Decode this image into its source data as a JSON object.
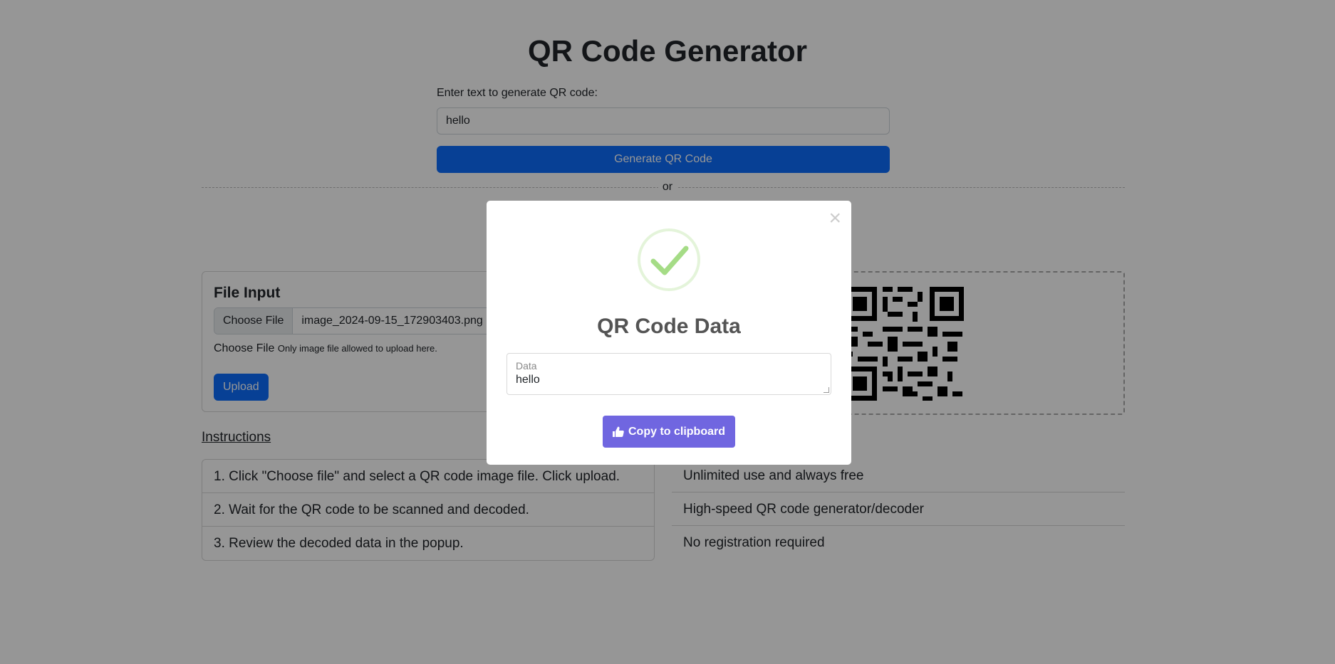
{
  "page": {
    "title": "QR Code Generator",
    "generate_label": "Enter text to generate QR code:",
    "generate_input_value": "hello",
    "generate_button": "Generate QR Code",
    "or_text": "or"
  },
  "file_input": {
    "heading": "File Input",
    "choose_button": "Choose File",
    "file_name": "image_2024-09-15_172903403.png",
    "hint_label": "Choose File",
    "hint_small": "Only image file allowed to upload here.",
    "upload_button": "Upload"
  },
  "instructions": {
    "heading": "Instructions",
    "items": [
      "1. Click \"Choose file\" and select a QR code image file. Click upload.",
      "2. Wait for the QR code to be scanned and decoded.",
      "3. Review the decoded data in the popup."
    ]
  },
  "features": {
    "items": [
      "Unlimited use and always free",
      "High-speed QR code generator/decoder",
      "No registration required"
    ]
  },
  "modal": {
    "close_glyph": "×",
    "icon": "success-check-icon",
    "title": "QR Code Data",
    "field_label": "Data",
    "field_value": "hello",
    "copy_button": "Copy to clipboard",
    "copy_icon": "thumbs-up-icon",
    "accent_color": "#7066e0",
    "success_color": "#a5dc86"
  },
  "colors": {
    "primary": "#0d6efd"
  }
}
